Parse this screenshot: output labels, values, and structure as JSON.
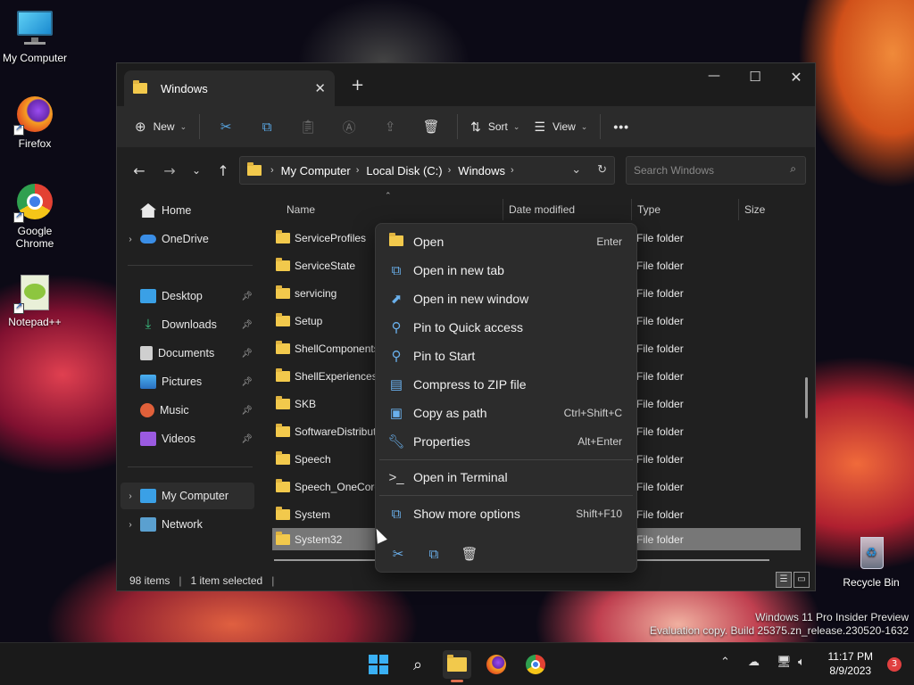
{
  "desktop": {
    "icons": [
      {
        "label": "My Computer"
      },
      {
        "label": "Firefox"
      },
      {
        "label": "Google Chrome"
      },
      {
        "label": "Notepad++"
      }
    ],
    "recycle_bin": "Recycle Bin",
    "watermark": {
      "line1": "Windows 11 Pro Insider Preview",
      "line2": "Evaluation copy. Build 25375.zn_release.230520-1632"
    }
  },
  "window": {
    "tab_title": "Windows",
    "toolbar": {
      "new_label": "New",
      "sort_label": "Sort",
      "view_label": "View",
      "more_label": "•••"
    },
    "address": {
      "crumbs": [
        "My Computer",
        "Local Disk (C:)",
        "Windows"
      ]
    },
    "search": {
      "placeholder": "Search Windows"
    },
    "sidebar": {
      "items": [
        {
          "label": "Home"
        },
        {
          "label": "OneDrive"
        },
        {
          "label": "Desktop"
        },
        {
          "label": "Downloads"
        },
        {
          "label": "Documents"
        },
        {
          "label": "Pictures"
        },
        {
          "label": "Music"
        },
        {
          "label": "Videos"
        },
        {
          "label": "My Computer"
        },
        {
          "label": "Network"
        }
      ]
    },
    "columns": {
      "name": "Name",
      "date": "Date modified",
      "type": "Type",
      "size": "Size"
    },
    "rows": [
      {
        "name": "ServiceProfiles",
        "type": "File folder"
      },
      {
        "name": "ServiceState",
        "type": "File folder"
      },
      {
        "name": "servicing",
        "type": "File folder"
      },
      {
        "name": "Setup",
        "type": "File folder"
      },
      {
        "name": "ShellComponents",
        "type": "File folder"
      },
      {
        "name": "ShellExperiences",
        "type": "File folder"
      },
      {
        "name": "SKB",
        "type": "File folder"
      },
      {
        "name": "SoftwareDistribut",
        "type": "File folder"
      },
      {
        "name": "Speech",
        "type": "File folder"
      },
      {
        "name": "Speech_OneCore",
        "type": "File folder"
      },
      {
        "name": "System",
        "type": "File folder"
      },
      {
        "name": "System32",
        "type": "File folder"
      }
    ],
    "status": {
      "items": "98 items",
      "selected": "1 item selected"
    }
  },
  "context_menu": {
    "items": [
      {
        "label": "Open",
        "shortcut": "Enter",
        "icon": "folder-open-icon"
      },
      {
        "label": "Open in new tab",
        "shortcut": "",
        "icon": "new-tab-icon"
      },
      {
        "label": "Open in new window",
        "shortcut": "",
        "icon": "new-window-icon"
      },
      {
        "label": "Pin to Quick access",
        "shortcut": "",
        "icon": "pin-icon"
      },
      {
        "label": "Pin to Start",
        "shortcut": "",
        "icon": "pin-start-icon"
      },
      {
        "label": "Compress to ZIP file",
        "shortcut": "",
        "icon": "zip-icon"
      },
      {
        "label": "Copy as path",
        "shortcut": "Ctrl+Shift+C",
        "icon": "copy-path-icon"
      },
      {
        "label": "Properties",
        "shortcut": "Alt+Enter",
        "icon": "wrench-icon"
      },
      {
        "label": "Open in Terminal",
        "shortcut": "",
        "icon": "terminal-icon"
      },
      {
        "label": "Show more options",
        "shortcut": "Shift+F10",
        "icon": "more-options-icon"
      }
    ]
  },
  "taskbar": {
    "time": "11:17 PM",
    "date": "8/9/2023",
    "notifications": "3"
  },
  "colors": {
    "accent": "#59a8e6",
    "folder": "#f2c94c",
    "selected_row": "#777777"
  }
}
